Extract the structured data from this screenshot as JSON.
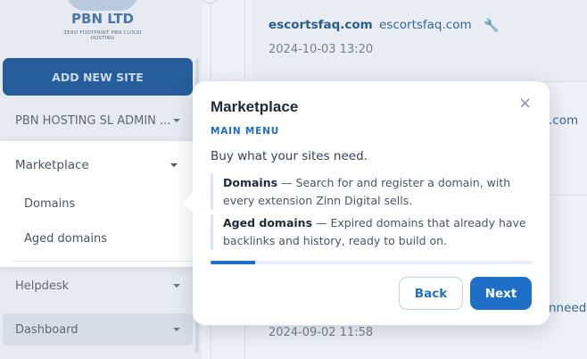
{
  "logo": {
    "title": "PBN LTD",
    "tagline": "ZERO FOOTPRINT PBN CLOUD HOSTING"
  },
  "sidebar": {
    "add_button": "ADD NEW SITE",
    "account_label": "PBN HOSTING SL ADMIN ...",
    "menu": {
      "label": "Marketplace",
      "items": [
        "Domains",
        "Aged domains"
      ]
    },
    "helpdesk_label": "Helpdesk",
    "dashboard_label": "Dashboard"
  },
  "sites": [
    {
      "domain": "escortsfaq.com",
      "url_label": "escortsfaq.com",
      "date": "2024-10-03 13:20"
    }
  ],
  "partial": {
    "row2_edge": ".com",
    "row4_edge": "nneed",
    "row4_date": "2024-09-02 11:58"
  },
  "tour": {
    "title": "Marketplace",
    "section": "MAIN MENU",
    "intro": "Buy what your sites need.",
    "features": [
      {
        "name": "Domains",
        "desc": " — Search for and register a domain, with every extension Zinn Digital sells."
      },
      {
        "name": "Aged domains",
        "desc": " — Expired domains that already have backlinks and history, ready to build on."
      }
    ],
    "progress_fraction": 0.14,
    "back_label": "Back",
    "next_label": "Next",
    "close_icon": "×"
  },
  "colors": {
    "accent": "#1e6fc8",
    "overlay": "#e7ebf1"
  }
}
